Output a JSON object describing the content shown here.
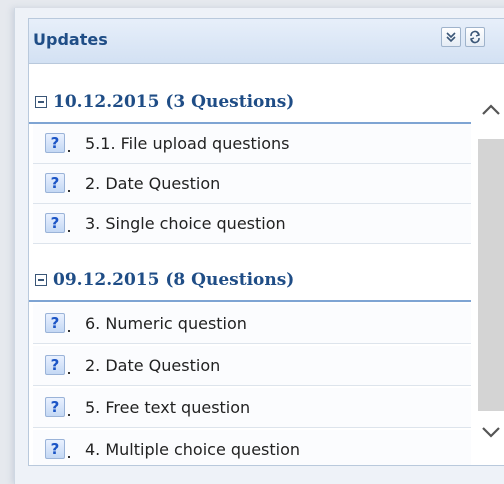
{
  "panel": {
    "title": "Updates"
  },
  "header_buttons": [
    {
      "icon": "collapse-double-chevron-icon"
    },
    {
      "icon": "refresh-icon"
    }
  ],
  "groups": [
    {
      "label": "10.12.2015 (3 Questions)",
      "items": [
        {
          "icon_text": "?",
          "label": "5.1. File upload questions"
        },
        {
          "icon_text": "?",
          "label": "2. Date Question"
        },
        {
          "icon_text": "?",
          "label": "3. Single choice question"
        }
      ]
    },
    {
      "label": "09.12.2015 (8 Questions)",
      "items": [
        {
          "icon_text": "?",
          "label": "6. Numeric question"
        },
        {
          "icon_text": "?",
          "label": "2. Date Question"
        },
        {
          "icon_text": "?",
          "label": "5. Free text question"
        },
        {
          "icon_text": "?",
          "label": "4. Multiple choice question"
        }
      ]
    }
  ],
  "colors": {
    "header_text": "#1f4d86",
    "group_border": "#7ea4d3",
    "question_icon": "#1c55c6"
  }
}
